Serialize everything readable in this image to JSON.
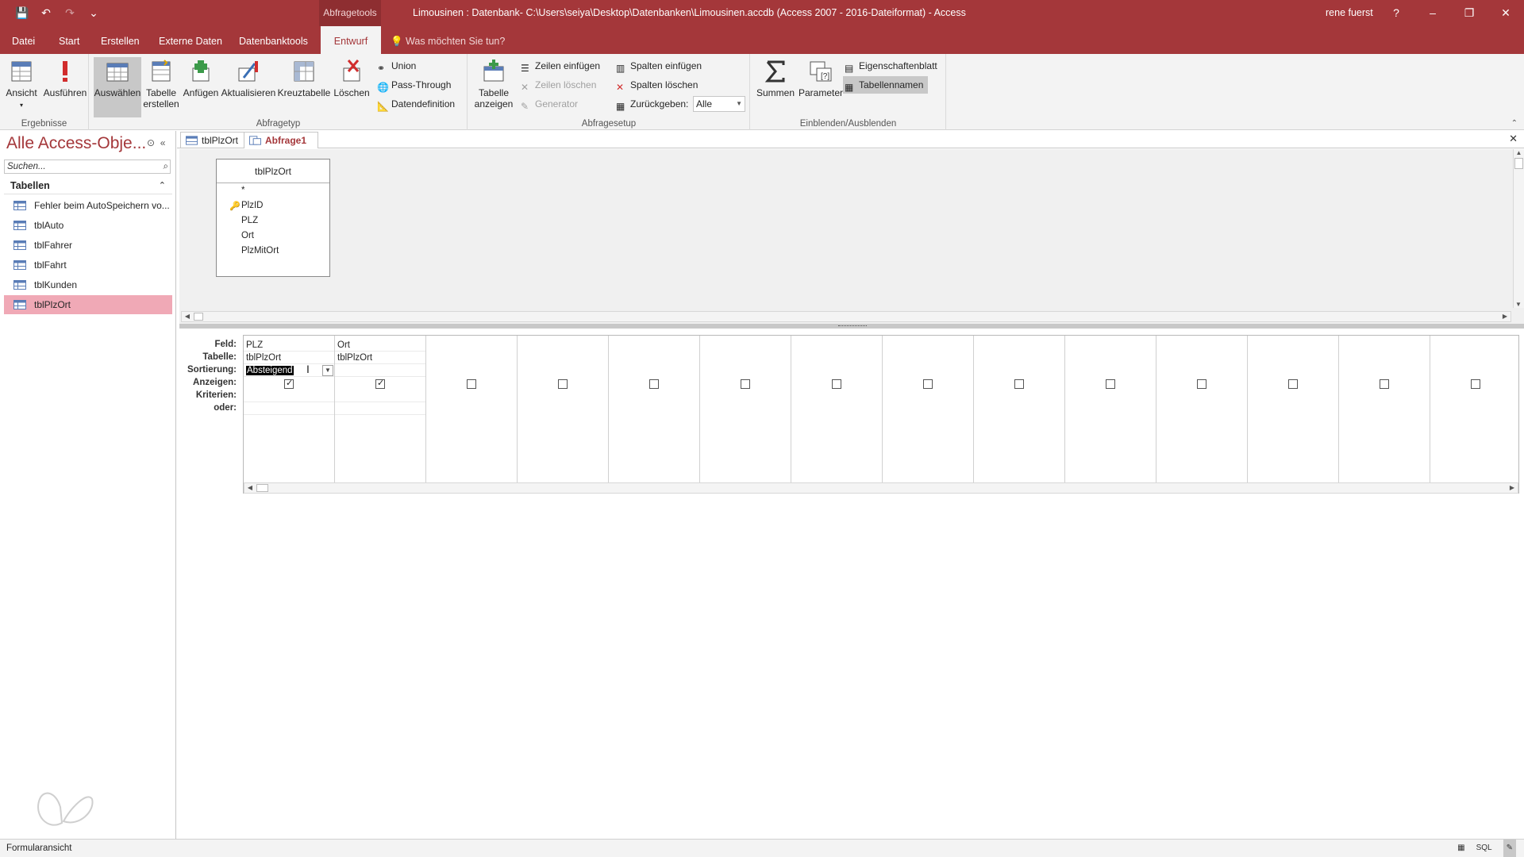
{
  "window": {
    "context_tab": "Abfragetools",
    "title": "Limousinen : Datenbank- C:\\Users\\seiya\\Desktop\\Datenbanken\\Limousinen.accdb (Access 2007 - 2016-Dateiformat)  -  Access",
    "user": "rene fuerst",
    "help": "?",
    "minimize": "–",
    "restore": "❐",
    "close": "✕"
  },
  "qat": {
    "save": "💾",
    "undo": "↶",
    "redo": "↷",
    "more": "⌄"
  },
  "tabs": [
    "Datei",
    "Start",
    "Erstellen",
    "Externe Daten",
    "Datenbanktools",
    "Entwurf"
  ],
  "tellme": "Was möchten Sie tun?",
  "ribbon": {
    "ergebnisse": {
      "label": "Ergebnisse",
      "ansicht": "Ansicht",
      "ausfuehren": "Ausführen"
    },
    "abfragetyp": {
      "label": "Abfragetyp",
      "auswaehlen": "Auswählen",
      "tabelle": "Tabelle",
      "erstellen": "erstellen",
      "anfuegen": "Anfügen",
      "aktualisieren": "Aktualisieren",
      "kreuztabelle": "Kreuztabelle",
      "loeschen": "Löschen",
      "union": "Union",
      "passthrough": "Pass-Through",
      "datendefinition": "Datendefinition"
    },
    "abfragesetup": {
      "label": "Abfragesetup",
      "tabelle": "Tabelle",
      "anzeigen": "anzeigen",
      "zeilen_einfuegen": "Zeilen einfügen",
      "zeilen_loeschen": "Zeilen löschen",
      "generator": "Generator",
      "spalten_einfuegen": "Spalten einfügen",
      "spalten_loeschen": "Spalten löschen",
      "zurueckgeben": "Zurückgeben:",
      "zurueckgeben_value": "Alle"
    },
    "einblenden": {
      "label": "Einblenden/Ausblenden",
      "summen": "Summen",
      "parameter": "Parameter",
      "eigenschaftenblatt": "Eigenschaftenblatt",
      "tabellennamen": "Tabellennamen"
    }
  },
  "nav": {
    "title": "Alle Access-Obje...",
    "search_placeholder": "Suchen...",
    "section": "Tabellen",
    "items": [
      "Fehler beim AutoSpeichern vo...",
      "tblAuto",
      "tblFahrer",
      "tblFahrt",
      "tblKunden",
      "tblPlzOrt"
    ],
    "selected": "tblPlzOrt"
  },
  "doctabs": [
    "tblPlzOrt",
    "Abfrage1"
  ],
  "tablebox": {
    "title": "tblPlzOrt",
    "fields": [
      "*",
      "PlzID",
      "PLZ",
      "Ort",
      "PlzMitOrt"
    ]
  },
  "grid": {
    "row_labels": [
      "Feld:",
      "Tabelle:",
      "Sortierung:",
      "Anzeigen:",
      "Kriterien:",
      "oder:"
    ],
    "columns": [
      {
        "feld": "PLZ",
        "tabelle": "tblPlzOrt",
        "sortierung": "Absteigend",
        "anzeigen": true
      },
      {
        "feld": "Ort",
        "tabelle": "tblPlzOrt",
        "sortierung": "",
        "anzeigen": true
      }
    ]
  },
  "status": {
    "text": "Formularansicht"
  }
}
